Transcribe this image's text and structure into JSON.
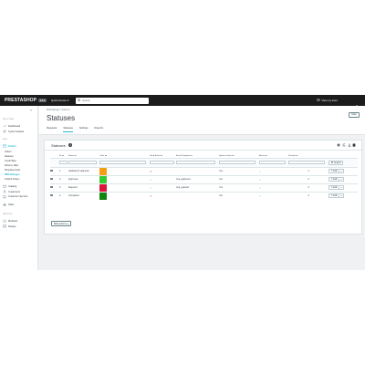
{
  "topbar": {
    "logo": "PRESTASHOP",
    "version": "8.0.0",
    "quick_access": "Quick Access",
    "search_placeholder": "Search",
    "view_shop": "View my store"
  },
  "sidebar": {
    "sections": [
      {
        "title": "WELCOME",
        "items": [
          {
            "label": "Dashboard",
            "icon": "trending-up-icon"
          },
          {
            "label": "Cycle Cookies",
            "icon": "gear-icon"
          }
        ]
      },
      {
        "title": "SELL",
        "items": [
          {
            "label": "Orders",
            "icon": "orders-icon"
          }
        ]
      }
    ],
    "orders_sub": [
      "Orders",
      "Statuses",
      "Credit Slips",
      "Delivery Slips",
      "Shopping Carts",
      "RMA Manager",
      "Outfoul Orders"
    ],
    "more_items": [
      {
        "label": "Catalog",
        "icon": "store-icon"
      },
      {
        "label": "Customers",
        "icon": "person-icon"
      },
      {
        "label": "Customer Service",
        "icon": "chat-icon"
      },
      {
        "label": "Stats",
        "icon": "bar-chart-icon"
      }
    ],
    "improve_title": "IMPROVE",
    "improve_items": [
      {
        "label": "Modules",
        "icon": "puzzle-icon"
      },
      {
        "label": "Design",
        "icon": "desktop-icon"
      }
    ]
  },
  "header": {
    "breadcrumb": "RMA Manager  /  Statuses",
    "title": "Statuses",
    "help": "Help",
    "tabs": [
      "Requests",
      "Statuses",
      "Settings",
      "Reports"
    ]
  },
  "card": {
    "title": "Statuses",
    "count": "4",
    "columns": [
      "ID",
      "Name",
      "Color",
      "Send Email",
      "Email Template",
      "System status",
      "Active",
      "Position"
    ],
    "search_label": "Search",
    "edit_label": "Edit",
    "bulk_label": "Bulk actions",
    "rows": [
      {
        "id": "1",
        "name": "Awaiting for approval",
        "color": "#f49e12",
        "send_email": "no",
        "template": "",
        "system": "Yes",
        "active": "yes",
        "position": "1"
      },
      {
        "id": "2",
        "name": "Approved",
        "color": "#32cd32",
        "send_email": "yes",
        "template": "rma_approved",
        "system": "Yes",
        "active": "yes",
        "position": "2"
      },
      {
        "id": "3",
        "name": "Rejected",
        "color": "#dc143c",
        "send_email": "yes",
        "template": "rma_rejected",
        "system": "Yes",
        "active": "yes",
        "position": "3"
      },
      {
        "id": "4",
        "name": "Completed",
        "color": "#108510",
        "send_email": "no",
        "template": "",
        "system": "Yes",
        "active": "yes",
        "position": "4"
      }
    ]
  },
  "colors": {
    "accent": "#24b9d7",
    "topbar": "#1c1c1c",
    "yes": "#70b580",
    "no": "#c05c67"
  }
}
